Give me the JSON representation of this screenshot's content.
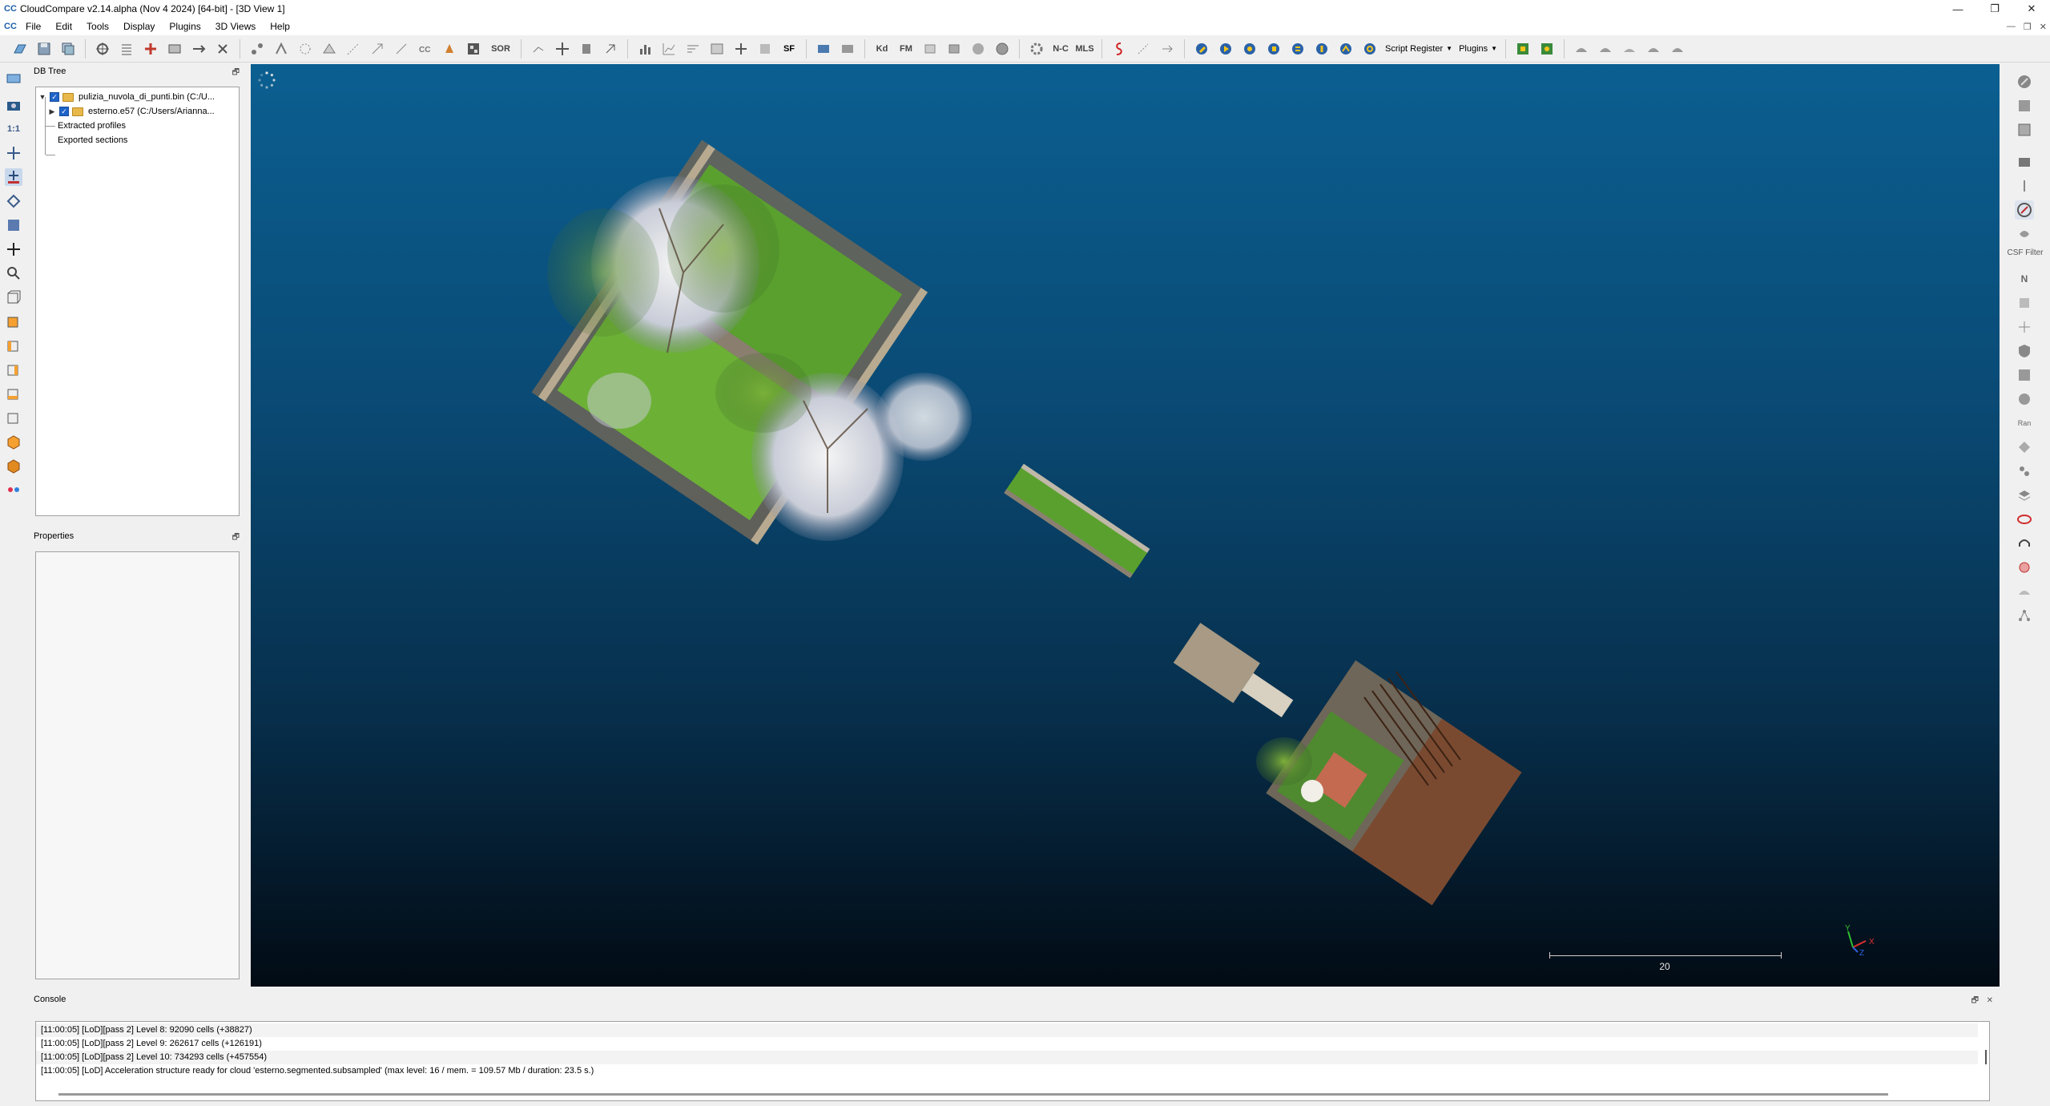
{
  "window": {
    "title": "CloudCompare v2.14.alpha (Nov  4 2024) [64-bit] - [3D View 1]",
    "app_logo": "CC",
    "controls": [
      "—",
      "❐",
      "✕"
    ]
  },
  "menubar": {
    "items": [
      "File",
      "Edit",
      "Tools",
      "Display",
      "Plugins",
      "3D Views",
      "Help"
    ],
    "mdi_controls": [
      "—",
      "❐",
      "✕"
    ]
  },
  "toolbar": {
    "script_register_label": "Script Register",
    "plugins_label": "Plugins",
    "sor_label": "SOR",
    "sf_label": "SF",
    "kd_label": "Kd",
    "fm_label": "FM",
    "mls_label": "MLS",
    "n_c_label": "N-C"
  },
  "left_toolbar": {
    "one_to_one_label": "1:1"
  },
  "right_toolbar": {
    "csf_filter_label": "CSF Filter",
    "n_label": "N",
    "ran_label": "Ran"
  },
  "db_tree": {
    "title": "DB Tree",
    "items": [
      {
        "label": "pulizia_nuvola_di_punti.bin (C:/U...",
        "level": 0,
        "expanded": true,
        "checked": true,
        "folder": true
      },
      {
        "label": "esterno.e57 (C:/Users/Arianna...",
        "level": 1,
        "expanded": false,
        "checked": true,
        "folder": true
      },
      {
        "label": "Extracted profiles",
        "level": 1,
        "expanded": false,
        "checked": false,
        "folder": false
      },
      {
        "label": "Exported sections",
        "level": 1,
        "expanded": false,
        "checked": false,
        "folder": false
      }
    ]
  },
  "properties": {
    "title": "Properties"
  },
  "view3d": {
    "scale_value": "20",
    "axis_labels": {
      "x": "X",
      "y": "Y",
      "z": "Z"
    },
    "background_top": "#0b5f91",
    "background_bottom": "#020b14"
  },
  "console": {
    "title": "Console",
    "lines": [
      "[11:00:05] [LoD][pass 2] Level 8: 92090 cells (+38827)",
      "[11:00:05] [LoD][pass 2] Level 9: 262617 cells (+126191)",
      "[11:00:05] [LoD][pass 2] Level 10: 734293 cells (+457554)",
      "[11:00:05] [LoD] Acceleration structure ready for cloud 'esterno.segmented.subsampled' (max level: 16 / mem. = 109.57 Mb / duration: 23.5 s.)"
    ]
  }
}
